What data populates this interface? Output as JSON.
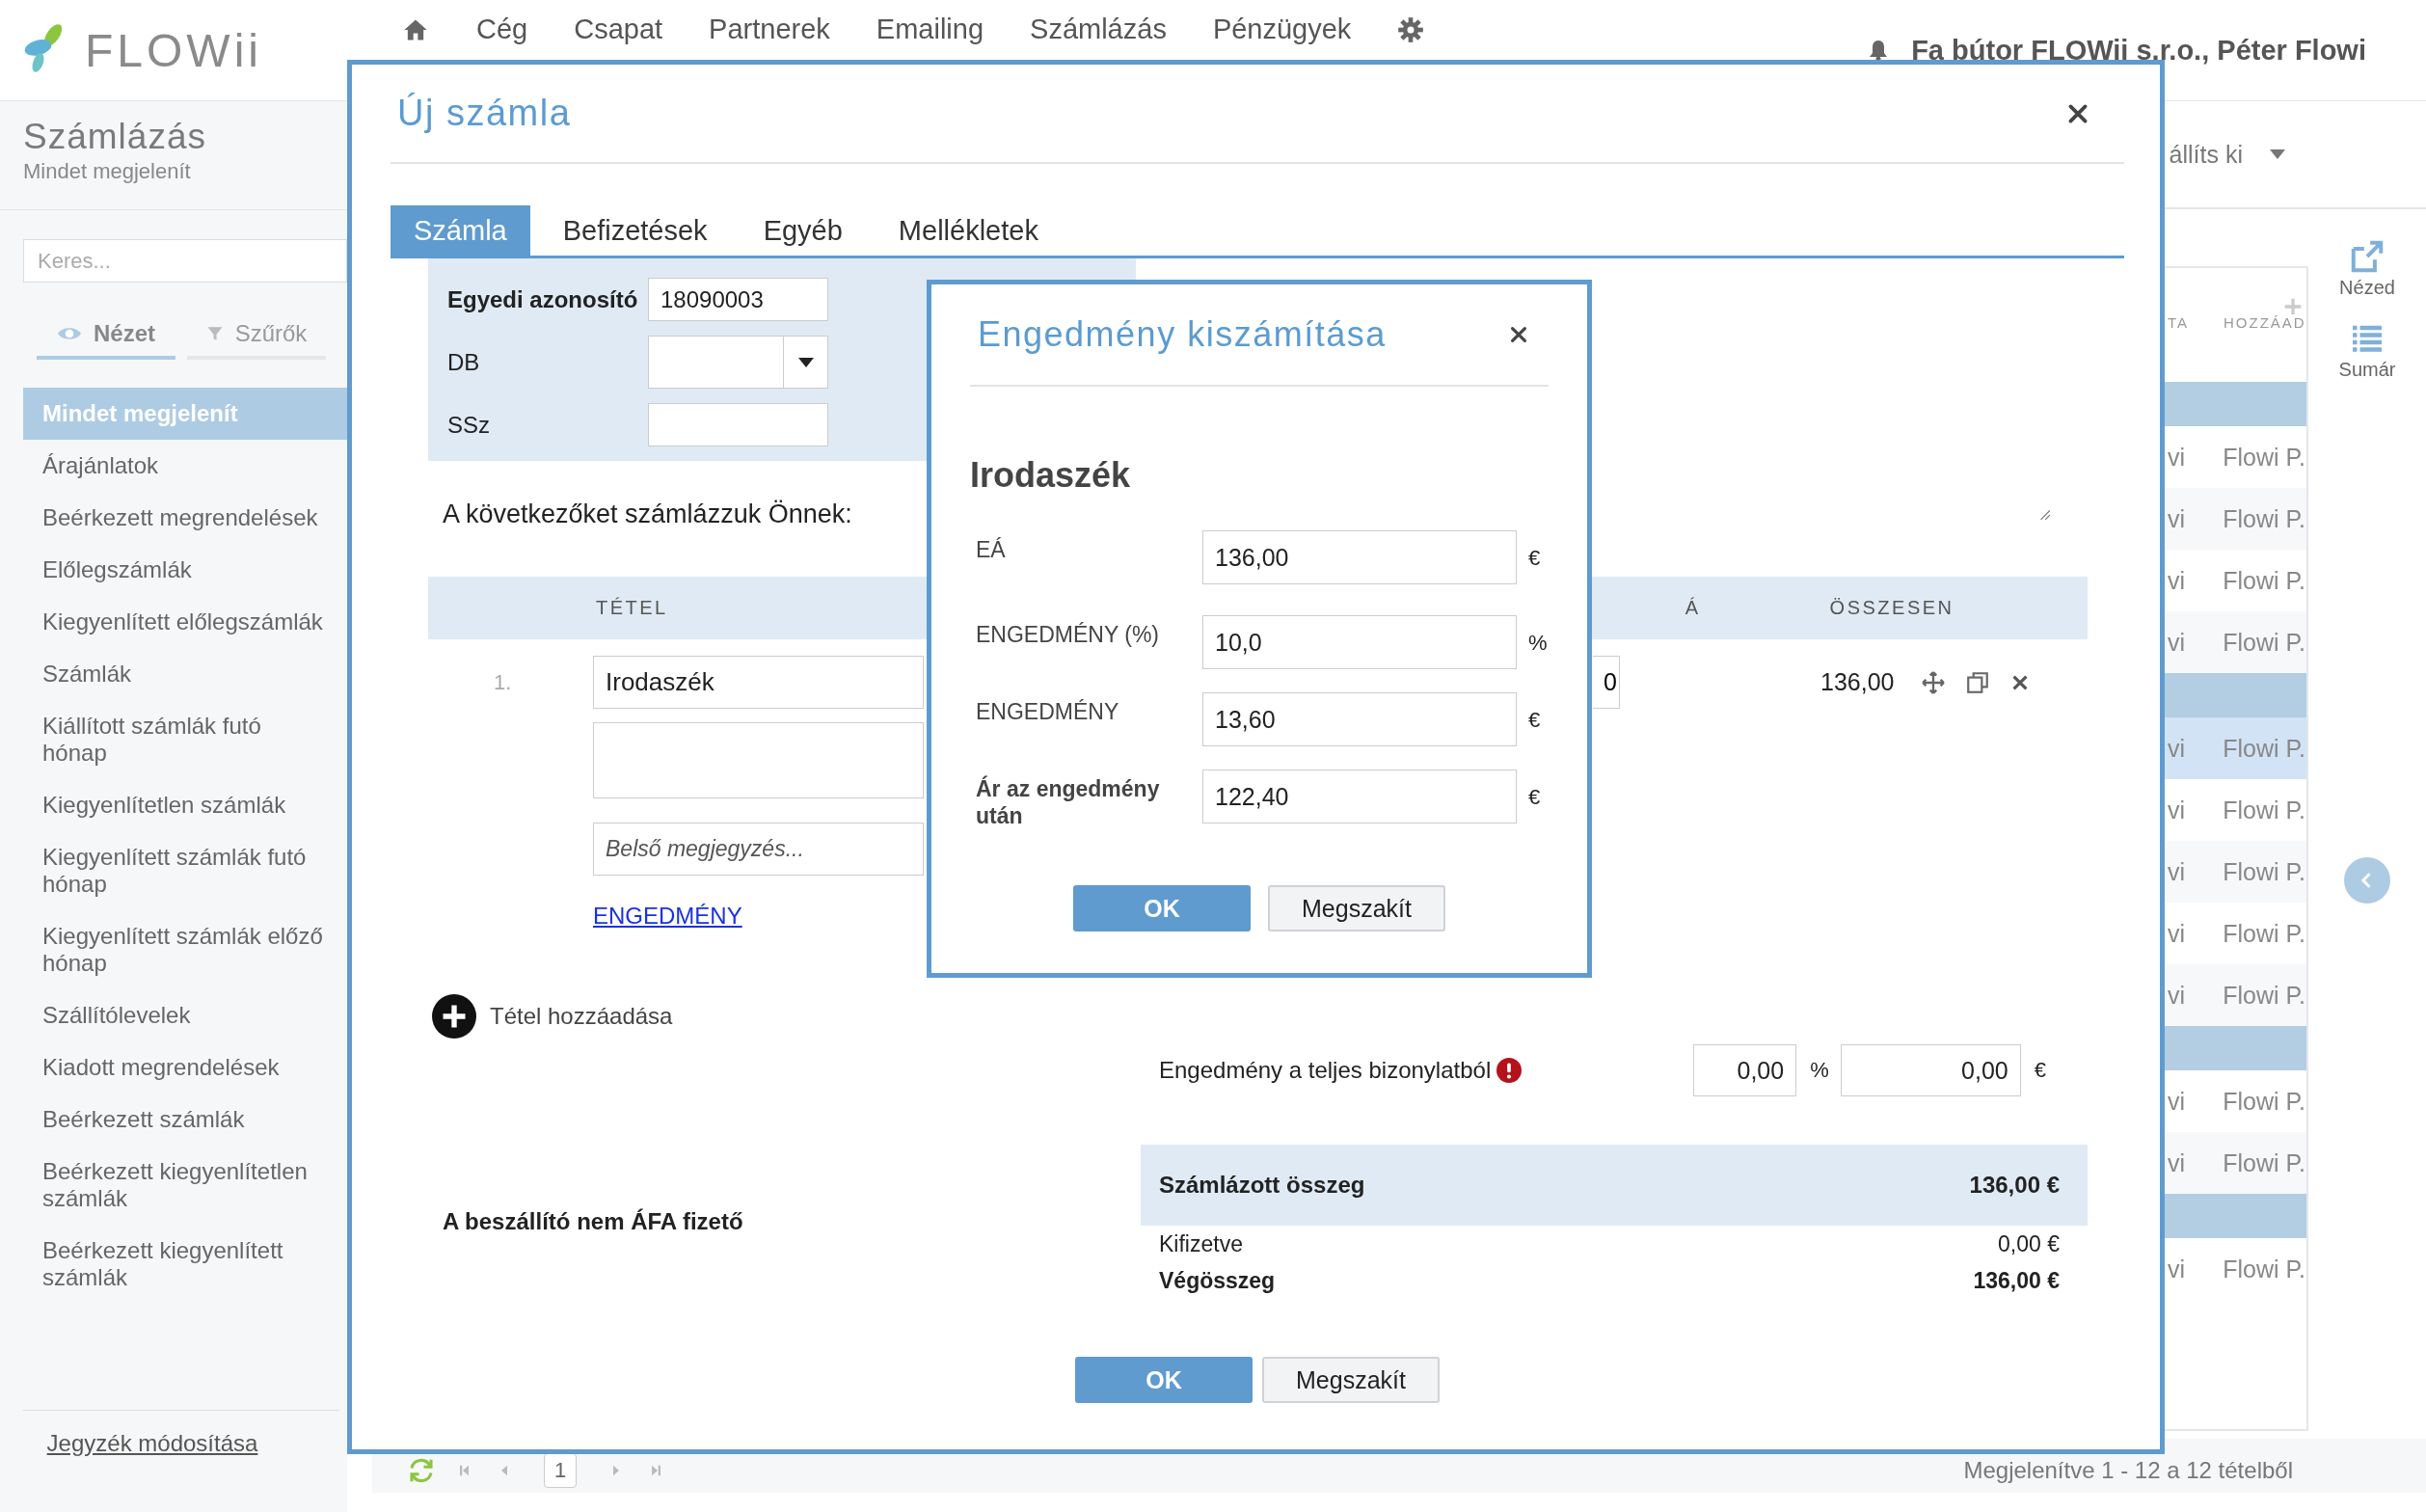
{
  "header": {
    "logo": "FLOWii",
    "nav": [
      "Cég",
      "Csapat",
      "Partnerek",
      "Emailing",
      "Számlázás",
      "Pénzügyek"
    ],
    "user": "Fa bútor FLOWii s.r.o., Péter Flowi"
  },
  "sidebar": {
    "title": "Számlázás",
    "subtitle": "Mindet megjelenít",
    "search": {
      "placeholder": "Keres..."
    },
    "tabs": [
      {
        "label": "Nézet",
        "selected": true
      },
      {
        "label": "Szűrők",
        "selected": false
      }
    ],
    "items": [
      {
        "label": "Mindet megjelenít",
        "selected": true
      },
      {
        "label": "Árajánlatok",
        "selected": false
      },
      {
        "label": "Beérkezett megrendelések",
        "selected": false
      },
      {
        "label": "Előlegszámlák",
        "selected": false
      },
      {
        "label": "Kiegyenlített előlegszámlák",
        "selected": false
      },
      {
        "label": "Számlák",
        "selected": false
      },
      {
        "label": "Kiállított számlák futó hónap",
        "selected": false
      },
      {
        "label": "Kiegyenlítetlen számlák",
        "selected": false
      },
      {
        "label": "Kiegyenlített számlák futó hónap",
        "selected": false
      },
      {
        "label": "Kiegyenlített számlák előző hónap",
        "selected": false
      },
      {
        "label": "Szállítólevelek",
        "selected": false
      },
      {
        "label": "Kiadott megrendelések",
        "selected": false
      },
      {
        "label": "Beérkezett számlák",
        "selected": false
      },
      {
        "label": "Beérkezett kiegyenlítetlen számlák",
        "selected": false
      },
      {
        "label": "Beérkezett kiegyenlített számlák",
        "selected": false
      }
    ],
    "footer_link": "Jegyzék módosítása"
  },
  "toolbar": {
    "menu": "állíts ki"
  },
  "list": {
    "columns": [
      "TA",
      "HOZZÁAD"
    ],
    "rows": [
      {
        "kind": "group"
      },
      {
        "kind": "row",
        "cells": [
          "vi",
          "Flowi P."
        ],
        "highlighted": false
      },
      {
        "kind": "row",
        "cells": [
          "vi",
          "Flowi P."
        ],
        "highlighted": false
      },
      {
        "kind": "row",
        "cells": [
          "vi",
          "Flowi P."
        ],
        "highlighted": false
      },
      {
        "kind": "row",
        "cells": [
          "vi",
          "Flowi P."
        ],
        "highlighted": false
      },
      {
        "kind": "group"
      },
      {
        "kind": "row",
        "cells": [
          "vi",
          "Flowi P."
        ],
        "highlighted": true
      },
      {
        "kind": "row",
        "cells": [
          "vi",
          "Flowi P."
        ],
        "highlighted": false
      },
      {
        "kind": "row",
        "cells": [
          "vi",
          "Flowi P."
        ],
        "highlighted": false
      },
      {
        "kind": "row",
        "cells": [
          "vi",
          "Flowi P."
        ],
        "highlighted": false
      },
      {
        "kind": "row",
        "cells": [
          "vi",
          "Flowi P."
        ],
        "highlighted": false
      },
      {
        "kind": "group"
      },
      {
        "kind": "row",
        "cells": [
          "vi",
          "Flowi P."
        ],
        "highlighted": false
      },
      {
        "kind": "row",
        "cells": [
          "vi",
          "Flowi P."
        ],
        "highlighted": false
      },
      {
        "kind": "group"
      },
      {
        "kind": "row",
        "cells": [
          "vi",
          "Flowi P."
        ],
        "highlighted": false
      }
    ]
  },
  "side_actions": [
    "Nézed",
    "Sumár"
  ],
  "pagination": {
    "page": "1",
    "summary": "Megjelenítve 1 - 12 a 12 tételből"
  },
  "invoice": {
    "title": "Új számla",
    "tabs": [
      {
        "label": "Számla",
        "selected": true
      },
      {
        "label": "Befizetések",
        "selected": false
      },
      {
        "label": "Egyéb",
        "selected": false
      },
      {
        "label": "Mellékletek",
        "selected": false
      }
    ],
    "fields": [
      {
        "label": "Egyedi azonosító",
        "value": "18090003",
        "kind": "text",
        "bold": true
      },
      {
        "label": "DB",
        "kind": "select",
        "bold": false
      },
      {
        "label": "SSz",
        "kind": "text",
        "bold": false
      }
    ],
    "intro": "A következőket számlázzuk Önnek:",
    "columns": [
      "TÉTEL",
      "Á",
      "ÖSSZESEN"
    ],
    "item": {
      "number": "1.",
      "name": "Irodaszék",
      "note_placeholder": "Belső megjegyzés...",
      "price": "0",
      "total": "136,00",
      "discount_link": "ENGEDMÉNY"
    },
    "add_item": "Tétel hozzáadása",
    "document_discount": {
      "label": "Engedmény a teljes bizonylatból",
      "percent": "0,00",
      "percent_unit": "%",
      "amount": "0,00",
      "currency": "€"
    },
    "vat_note": "A beszállító nem ÁFA fizető",
    "summary": {
      "invoiced_label": "Számlázott összeg",
      "invoiced": "136,00 €",
      "paid_label": "Kifizetve",
      "paid": "0,00 €",
      "total_label": "Végösszeg",
      "total": "136,00 €"
    },
    "buttons": [
      {
        "label": "OK",
        "kind": "primary"
      },
      {
        "label": "Megszakít",
        "kind": "secondary"
      }
    ]
  },
  "discount_dialog": {
    "title": "Engedmény kiszámítása",
    "item": "Irodaszék",
    "fields": [
      {
        "label": "EÁ",
        "value": "136,00",
        "unit": "€",
        "bold": false
      },
      {
        "label": "ENGEDMÉNY (%)",
        "value": "10,0",
        "unit": "%",
        "bold": false
      },
      {
        "label": "ENGEDMÉNY",
        "value": "13,60",
        "unit": "€",
        "bold": false
      },
      {
        "label": "Ár az engedmény után",
        "value": "122,40",
        "unit": "€",
        "bold": true
      }
    ],
    "buttons": [
      {
        "label": "OK",
        "kind": "primary"
      },
      {
        "label": "Megszakít",
        "kind": "secondary"
      }
    ]
  }
}
